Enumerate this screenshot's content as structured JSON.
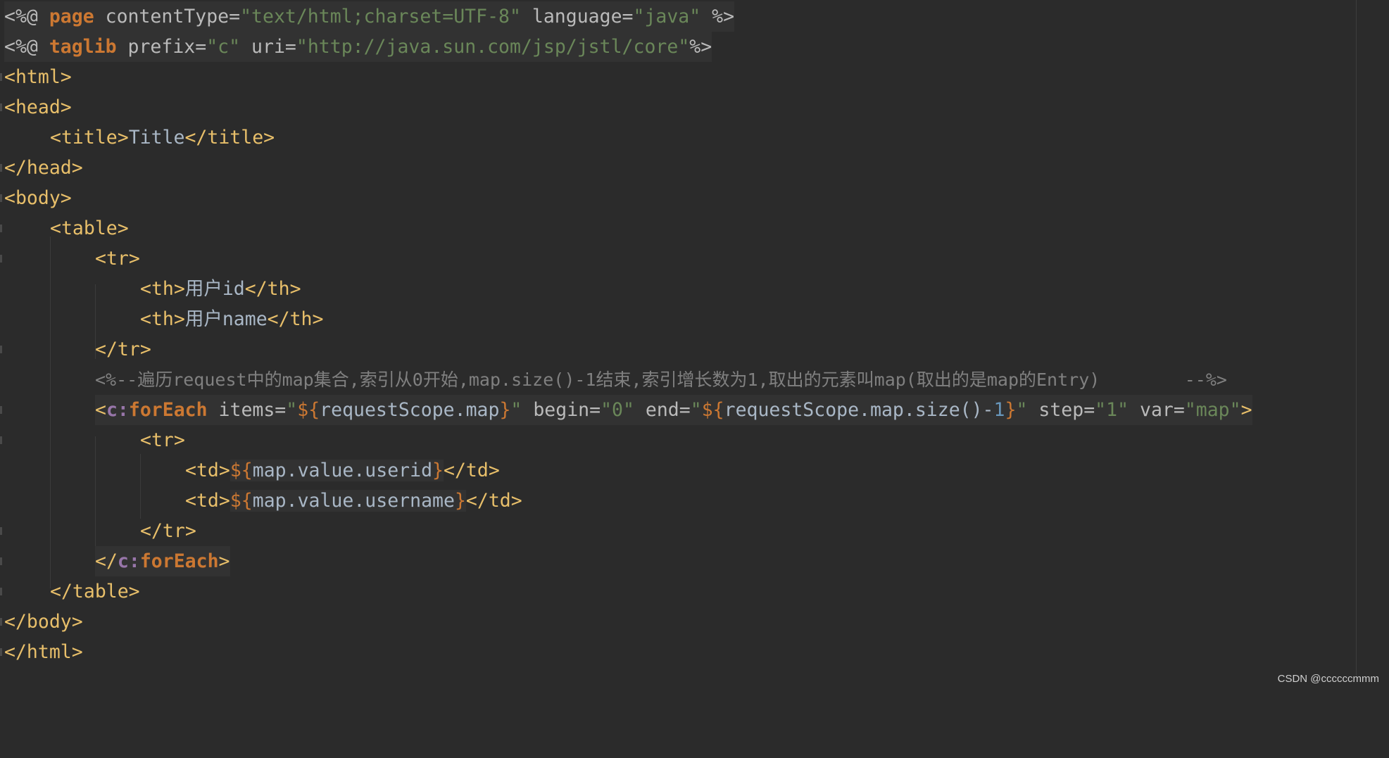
{
  "editor": {
    "language": "JSP",
    "theme": "Darcula"
  },
  "lines": {
    "l1": {
      "a": "<%@ ",
      "b": "page",
      "c": " contentType=",
      "d": "\"text/html;charset=UTF-8\"",
      "e": " language=",
      "f": "\"java\"",
      "g": " %>"
    },
    "l2": {
      "a": "<%@ ",
      "b": "taglib",
      "c": " prefix=",
      "d": "\"c\"",
      "e": " uri=",
      "f": "\"",
      "g": "http://java.sun.com/jsp/jstl/core",
      "h": "\"",
      "i": "%>"
    },
    "l3": {
      "a": "<html>"
    },
    "l4": {
      "a": "<head>"
    },
    "l5": {
      "a": "<title>",
      "b": "Title",
      "c": "</title>"
    },
    "l6": {
      "a": "</head>"
    },
    "l7": {
      "a": "<body>"
    },
    "l8": {
      "a": "<table>"
    },
    "l9": {
      "a": "<tr>"
    },
    "l10": {
      "a": "<th>",
      "b": "用户id",
      "c": "</th>"
    },
    "l11": {
      "a": "<th>",
      "b": "用户name",
      "c": "</th>"
    },
    "l12": {
      "a": "</tr>"
    },
    "l13": {
      "a": "<%--遍历request中的map集合,索引从0开始,map.size()-1结束,索引增长数为1,取出的元素叫map(取出的是map的Entry)        --%>"
    },
    "l14": {
      "a": "<",
      "b": "c:",
      "c": "forEach",
      "d": " items=",
      "e": "\"",
      "f": "${",
      "g": "requestScope.map",
      "h": "}",
      "i": "\"",
      "j": " begin=",
      "k": "\"0\"",
      "l": " end=",
      "m": "\"",
      "n": "${",
      "o": "requestScope.map.size()-",
      "p": "1",
      "q": "}",
      "r": "\"",
      "s": " step=",
      "t": "\"1\"",
      "u": " var=",
      "v": "\"map\"",
      "w": ">"
    },
    "l15": {
      "a": "<tr>"
    },
    "l16": {
      "a": "<td>",
      "b": "${",
      "c": "map.value.userid",
      "d": "}",
      "e": "</td>"
    },
    "l17": {
      "a": "<td>",
      "b": "${",
      "c": "map.value.username",
      "d": "}",
      "e": "</td>"
    },
    "l18": {
      "a": "</tr>"
    },
    "l19": {
      "a": "</",
      "b": "c:",
      "c": "forEach",
      "d": ">"
    },
    "l20": {
      "a": "</table>"
    },
    "l21": {
      "a": "</body>"
    },
    "l22": {
      "a": "</html>"
    }
  },
  "watermark": "CSDN @ccccccmmm"
}
